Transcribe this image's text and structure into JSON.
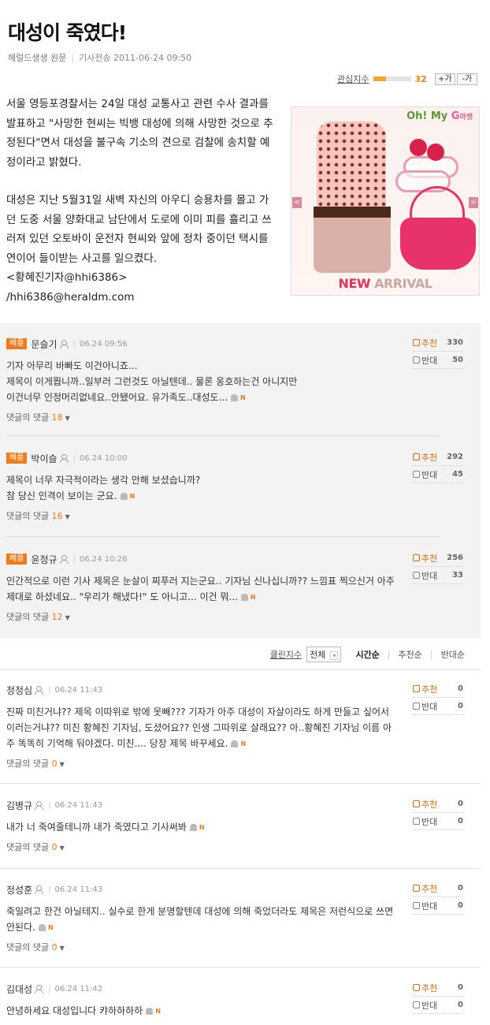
{
  "article": {
    "title": "대성이 죽였다!",
    "source": "헤럴드생생 원문",
    "sent_label": "기사전송",
    "sent_time": "2011-06-24 09:50",
    "interest_label": "관심지수",
    "interest_value": "32",
    "interest_fraction": 0.32,
    "font_up": "+가",
    "font_down": "-가",
    "paragraph1": "서울 영등포경찰서는 24일 대성 교통사고 관련 수사 결과를 발표하고 \"사망한 현씨는 빅뱅 대성에 의해 사망한 것으로 추정된다\"면서 대성을 불구속 기소의 견으로 검찰에 송치할 예정이라고 밝혔다.",
    "paragraph2": "대성은 지난 5월31일 새벽 자신의 아우디 승용차를 몰고 가던 도중 서울 양화대교 남단에서 도로에 이미 피를 흘리고 쓰러져 있던 오토바이 운전자 현씨와 앞에 정차 중이던 택시를 연이어 들이받는 사고를 일으켰다.",
    "byline": "<황혜진기자@hhi6386>",
    "email": "/hhi6386@heraldm.com"
  },
  "ad": {
    "logo_a": "Oh! My",
    "logo_g": "G",
    "logo_small": "마켓",
    "tag_new": "NEW",
    "tag_rest": " ARRIVAL",
    "prev_arrow": "<",
    "next_arrow": ">"
  },
  "best_comments": [
    {
      "badge": "베플",
      "author": "문슬기",
      "date": "06.24 09:56",
      "text": "기자 아무리 바빠도 이건아니죠...\n제목이 이게뭡니까..일부러 그런것도 아닐텐데.. 물론 옹호하는건 아니지만\n이건너무 인정머리없네요..안됐어요. 유가족도..대성도...",
      "replies_label": "댓글의 댓글",
      "replies": "18",
      "up_label": "추천",
      "up": "330",
      "down_label": "반대",
      "down": "50"
    },
    {
      "badge": "베플",
      "author": "박이슬",
      "date": "06.24 10:00",
      "text": "제목이 너무 자극적이라는 생각 안해 보셨습니까?\n참 당신 인격이 보이는 군요.",
      "replies_label": "댓글의 댓글",
      "replies": "16",
      "up_label": "추천",
      "up": "292",
      "down_label": "반대",
      "down": "45"
    },
    {
      "badge": "베플",
      "author": "윤정규",
      "date": "06.24 10:26",
      "text": "인간적으로 이런 기사 제목은 눈살이 찌푸러 지는군요.. 기자님 신나십니까?? 느낌표 찍으신거 아주 제대로 하셨네요.. \"우리가 해냈다!\" 도 아니고... 이건 뭐...",
      "replies_label": "댓글의 댓글",
      "replies": "12",
      "up_label": "추천",
      "up": "256",
      "down_label": "반대",
      "down": "33"
    }
  ],
  "sort": {
    "clean_label": "클린지수",
    "select_value": "전체",
    "options": [
      "시간순",
      "추천순",
      "반대순"
    ]
  },
  "comments": [
    {
      "author": "정정심",
      "date": "06.24 11:43",
      "text": "진짜 미친거냐?? 제목 이따위로 밖에 못빼??? 기자가 아주 대성이 자살이라도 하게 만들고 싶어서 이러는거냐?? 미친 황혜진 기자님, 도셨어요?? 인생 그따위로 살래요?? 아..황혜진 기자님 이름 아주 똑똑히 기억해 둬야겠다. 미친.... 당장 제목 바꾸세요.",
      "replies_label": "댓글의 댓글",
      "replies": "0",
      "up_label": "추천",
      "up": "0",
      "down_label": "반대",
      "down": "0"
    },
    {
      "author": "김병규",
      "date": "06.24 11:43",
      "text": "내가 너 죽여줄테니까 내가 죽였다고 기사써봐",
      "replies_label": "댓글의 댓글",
      "replies": "0",
      "up_label": "추천",
      "up": "0",
      "down_label": "반대",
      "down": "0"
    },
    {
      "author": "정성훈",
      "date": "06.24 11:43",
      "text": "죽일려고 한건 아닐테지.. 실수로 한게 분명할텐데 대성에 의해 죽었더라도 제목은 저런식으로 쓰면 안된다.",
      "replies_label": "댓글의 댓글",
      "replies": "0",
      "up_label": "추천",
      "up": "0",
      "down_label": "반대",
      "down": "0"
    },
    {
      "author": "김대성",
      "date": "06.24 11:42",
      "text": "안녕하세요 대성입니다 캬하하하하",
      "up_label": "추천",
      "up": "0",
      "down_label": "반대",
      "down": "0"
    }
  ]
}
